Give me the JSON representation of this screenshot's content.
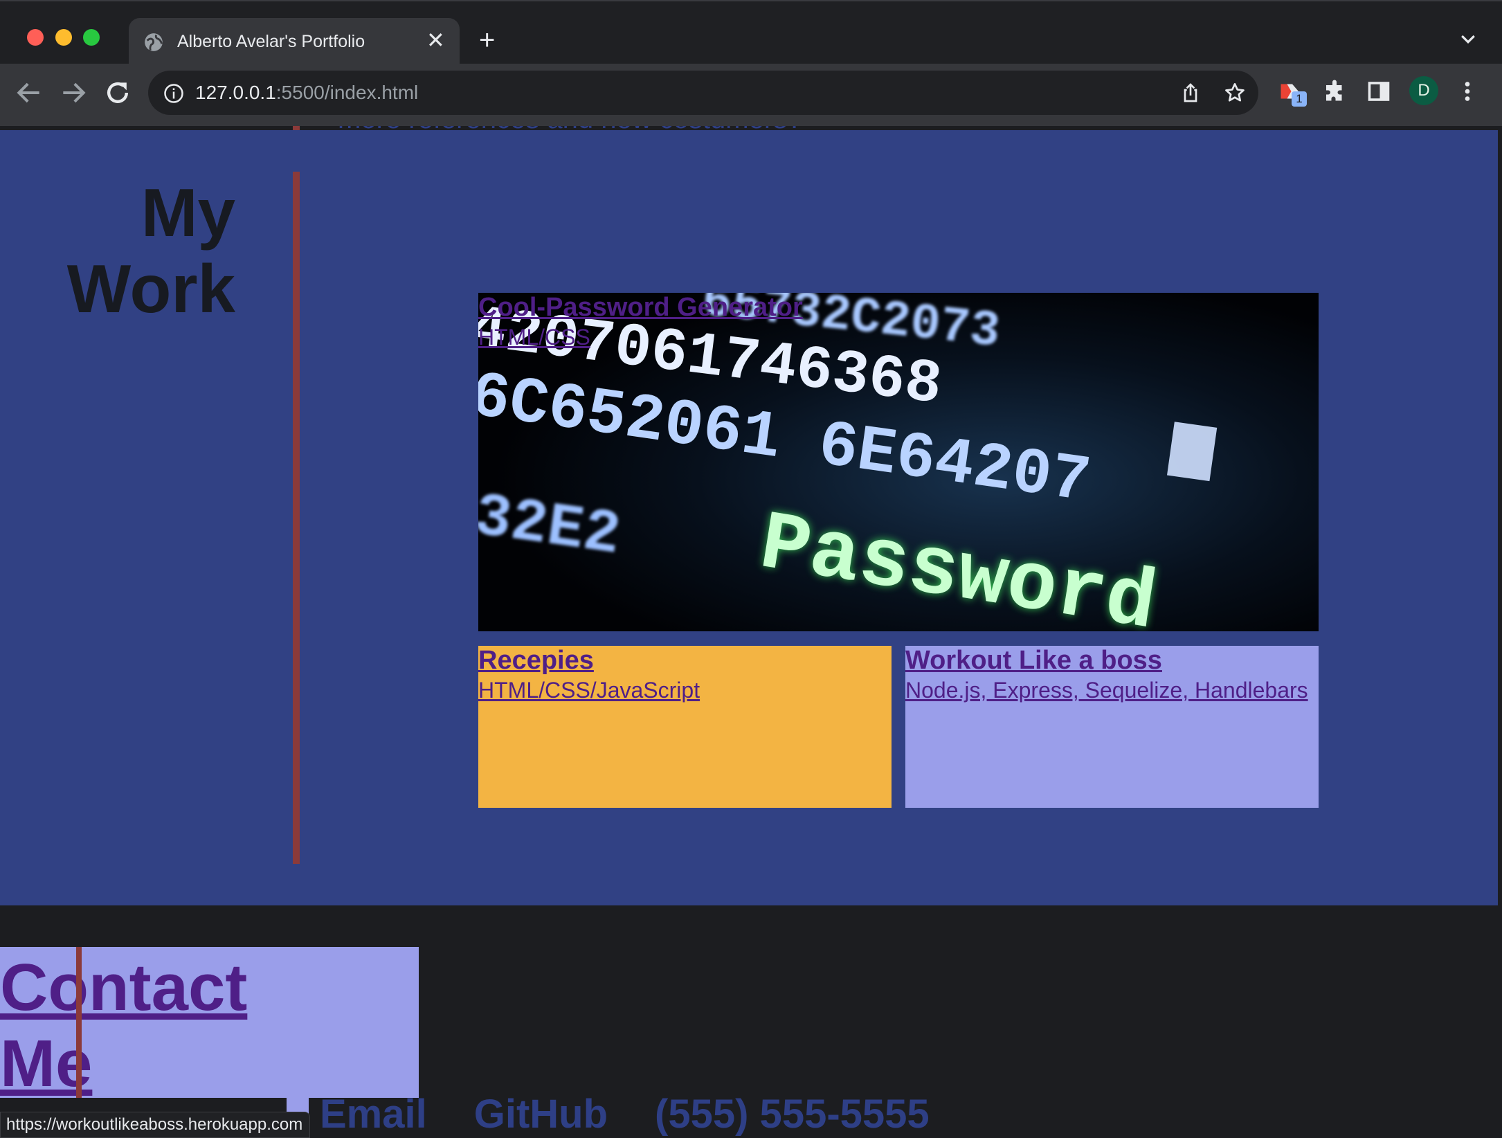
{
  "browser": {
    "tab_title": "Alberto Avelar's Portfolio",
    "url_host": "127.0.0.1",
    "url_path": ":5500/index.html",
    "profile_initial": "D",
    "extension_badge": "1"
  },
  "page": {
    "previous_section_text": "more references and new costumers?",
    "work": {
      "title": "My Work",
      "projects": [
        {
          "title": "Cool-Password  Generator",
          "tech": "HTML/CSS",
          "image_texts": [
            "65732C2073",
            "4207061746368",
            "6C652061 6E64207",
            "32E2",
            "Password"
          ]
        },
        {
          "title": "Recepies",
          "tech": "HTML/CSS/JavaScript",
          "bg": "#f3b443"
        },
        {
          "title": "Workout Like a boss",
          "tech": "Node.js, Express, Sequelize, Handlebars",
          "bg": "#9a9eea"
        }
      ]
    },
    "contact": {
      "title": "Contact Me",
      "links": [
        "Email",
        "GitHub",
        "(555) 555-5555"
      ]
    },
    "status_url": "https://workoutlikeaboss.herokuapp.com"
  },
  "colors": {
    "work_bg": "#314184",
    "accent_bar": "#8b3a3a",
    "link": "#4f1f87",
    "contact_box": "#9a9eea"
  }
}
